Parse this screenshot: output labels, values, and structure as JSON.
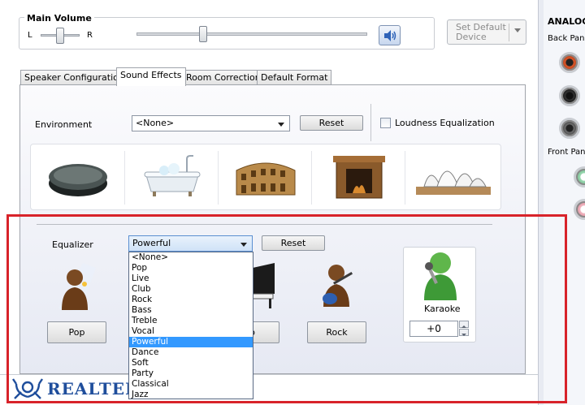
{
  "main_volume": {
    "title": "Main Volume",
    "left_label": "L",
    "right_label": "R",
    "set_default": "Set Default Device"
  },
  "right_panel": {
    "title": "ANALOG",
    "back_panel": "Back Panel",
    "front_panel": "Front Panel"
  },
  "tabs": [
    {
      "label": "Speaker Configuration"
    },
    {
      "label": "Sound Effects"
    },
    {
      "label": "Room Correction"
    },
    {
      "label": "Default Format"
    }
  ],
  "environment": {
    "label": "Environment",
    "selected": "<None>",
    "reset_label": "Reset",
    "loudness_label": "Loudness Equalization",
    "icons": [
      "stone-icon",
      "bathtub-icon",
      "colosseum-icon",
      "fireplace-icon",
      "opera-house-icon"
    ]
  },
  "equalizer": {
    "label": "Equalizer",
    "selected": "Powerful",
    "reset_label": "Reset",
    "options": [
      "<None>",
      "Pop",
      "Live",
      "Club",
      "Rock",
      "Bass",
      "Treble",
      "Vocal",
      "Powerful",
      "Dance",
      "Soft",
      "Party",
      "Classical",
      "Jazz"
    ],
    "presets": [
      {
        "label": "Pop"
      },
      {
        "label": "b"
      },
      {
        "label": "Rock"
      }
    ]
  },
  "karaoke": {
    "label": "Karaoke",
    "value": "+0"
  },
  "brand": "REALTEK",
  "colors": {
    "highlight": "#d8232a",
    "brand": "#1f4e9c",
    "selection": "#3399ff"
  }
}
